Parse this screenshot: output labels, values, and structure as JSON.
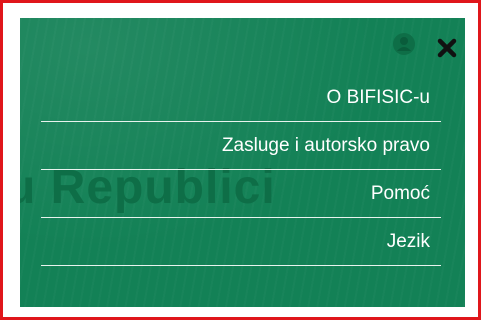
{
  "background_word": "u Republici",
  "menu": {
    "items": [
      {
        "label": "O BIFISIC-u"
      },
      {
        "label": "Zasluge i autorsko pravo"
      },
      {
        "label": "Pomoć"
      },
      {
        "label": "Jezik"
      }
    ]
  },
  "icons": {
    "close": "close-icon",
    "user": "user-icon"
  },
  "colors": {
    "panel_bg": "#138156",
    "frame_border": "#e0161b",
    "text": "#ffffff"
  }
}
